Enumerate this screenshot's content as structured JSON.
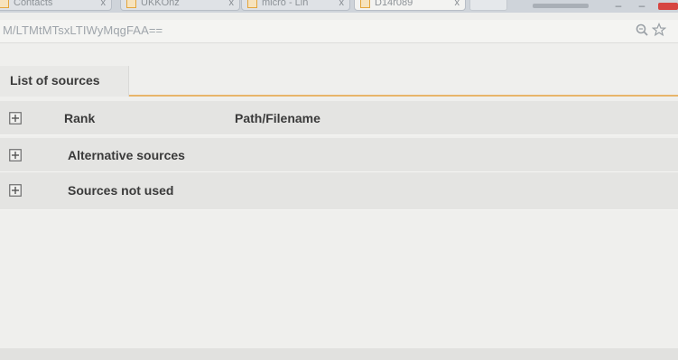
{
  "browser": {
    "tabs": [
      {
        "title": "Contacts",
        "active": false
      },
      {
        "title": "UKKOnz",
        "active": false
      },
      {
        "title": "micro - Lin",
        "active": false
      },
      {
        "title": "D14r089",
        "active": true
      }
    ],
    "close_glyph": "x",
    "window_controls": {
      "minimize": "–",
      "maximize": "–"
    },
    "address": {
      "url": "M/LTMtMTsxLTIWyMqgFAA==",
      "icons": [
        "zoom-icon",
        "bookmark-star-icon"
      ]
    }
  },
  "section_tab": {
    "label": "List of sources"
  },
  "sources_table": {
    "columns": [
      "Rank",
      "Path/Filename"
    ],
    "groups": [
      {
        "label": "Alternative sources"
      },
      {
        "label": "Sources not used"
      }
    ]
  },
  "colors": {
    "accent_underline": "#e8b56a",
    "row_background": "#e4e4e2",
    "tab_favicon": "#e4a53c",
    "window_close": "#d64541"
  }
}
